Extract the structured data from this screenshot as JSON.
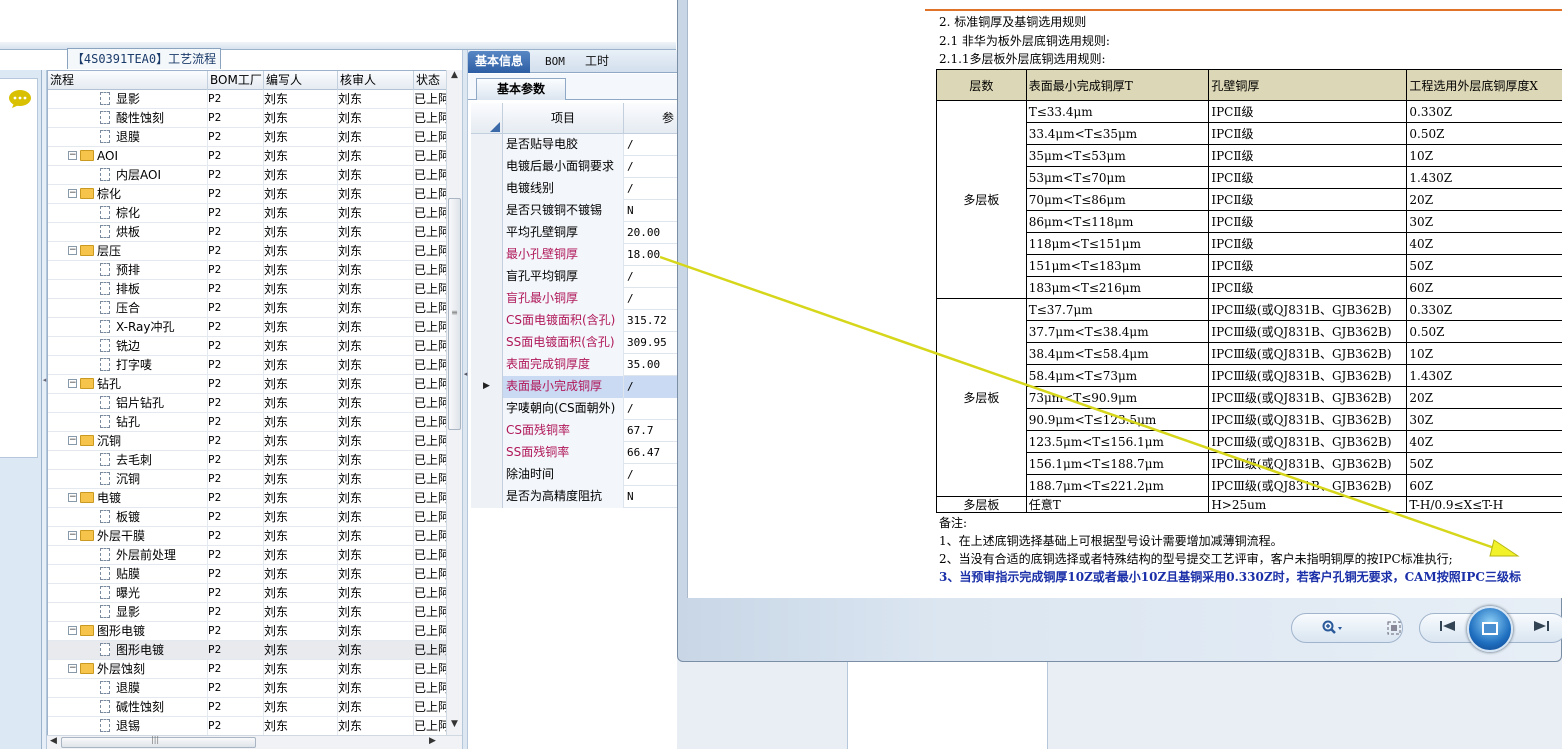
{
  "process_tab": {
    "title": "【4S0391TEA0】工艺流程"
  },
  "tree": {
    "columns": [
      "流程",
      "BOM工厂",
      "编写人",
      "核审人",
      "状态"
    ],
    "rows": [
      {
        "name": "显影",
        "level": 2,
        "bom": "P2",
        "writer": "刘东",
        "checker": "刘东",
        "status": "已上阿"
      },
      {
        "name": "酸性蚀刻",
        "level": 2,
        "bom": "P2",
        "writer": "刘东",
        "checker": "刘东",
        "status": "已上阿"
      },
      {
        "name": "退膜",
        "level": 2,
        "bom": "P2",
        "writer": "刘东",
        "checker": "刘东",
        "status": "已上阿"
      },
      {
        "name": "AOI",
        "level": 1,
        "bom": "P2",
        "writer": "刘东",
        "checker": "刘东",
        "status": "已上阿"
      },
      {
        "name": "内层AOI",
        "level": 2,
        "bom": "P2",
        "writer": "刘东",
        "checker": "刘东",
        "status": "已上阿"
      },
      {
        "name": "棕化",
        "level": 1,
        "bom": "P2",
        "writer": "刘东",
        "checker": "刘东",
        "status": "已上阿"
      },
      {
        "name": "棕化",
        "level": 2,
        "bom": "P2",
        "writer": "刘东",
        "checker": "刘东",
        "status": "已上阿"
      },
      {
        "name": "烘板",
        "level": 2,
        "bom": "P2",
        "writer": "刘东",
        "checker": "刘东",
        "status": "已上阿"
      },
      {
        "name": "层压",
        "level": 1,
        "bom": "P2",
        "writer": "刘东",
        "checker": "刘东",
        "status": "已上阿"
      },
      {
        "name": "预排",
        "level": 2,
        "bom": "P2",
        "writer": "刘东",
        "checker": "刘东",
        "status": "已上阿"
      },
      {
        "name": "排板",
        "level": 2,
        "bom": "P2",
        "writer": "刘东",
        "checker": "刘东",
        "status": "已上阿"
      },
      {
        "name": "压合",
        "level": 2,
        "bom": "P2",
        "writer": "刘东",
        "checker": "刘东",
        "status": "已上阿"
      },
      {
        "name": "X-Ray冲孔",
        "level": 2,
        "bom": "P2",
        "writer": "刘东",
        "checker": "刘东",
        "status": "已上阿"
      },
      {
        "name": "铣边",
        "level": 2,
        "bom": "P2",
        "writer": "刘东",
        "checker": "刘东",
        "status": "已上阿"
      },
      {
        "name": "打字唛",
        "level": 2,
        "bom": "P2",
        "writer": "刘东",
        "checker": "刘东",
        "status": "已上阿"
      },
      {
        "name": "钻孔",
        "level": 1,
        "bom": "P2",
        "writer": "刘东",
        "checker": "刘东",
        "status": "已上阿"
      },
      {
        "name": "铝片钻孔",
        "level": 2,
        "bom": "P2",
        "writer": "刘东",
        "checker": "刘东",
        "status": "已上阿"
      },
      {
        "name": "钻孔",
        "level": 2,
        "bom": "P2",
        "writer": "刘东",
        "checker": "刘东",
        "status": "已上阿"
      },
      {
        "name": "沉铜",
        "level": 1,
        "bom": "P2",
        "writer": "刘东",
        "checker": "刘东",
        "status": "已上阿"
      },
      {
        "name": "去毛刺",
        "level": 2,
        "bom": "P2",
        "writer": "刘东",
        "checker": "刘东",
        "status": "已上阿"
      },
      {
        "name": "沉铜",
        "level": 2,
        "bom": "P2",
        "writer": "刘东",
        "checker": "刘东",
        "status": "已上阿"
      },
      {
        "name": "电镀",
        "level": 1,
        "bom": "P2",
        "writer": "刘东",
        "checker": "刘东",
        "status": "已上阿"
      },
      {
        "name": "板镀",
        "level": 2,
        "bom": "P2",
        "writer": "刘东",
        "checker": "刘东",
        "status": "已上阿"
      },
      {
        "name": "外层干膜",
        "level": 1,
        "bom": "P2",
        "writer": "刘东",
        "checker": "刘东",
        "status": "已上阿"
      },
      {
        "name": "外层前处理",
        "level": 2,
        "bom": "P2",
        "writer": "刘东",
        "checker": "刘东",
        "status": "已上阿"
      },
      {
        "name": "贴膜",
        "level": 2,
        "bom": "P2",
        "writer": "刘东",
        "checker": "刘东",
        "status": "已上阿"
      },
      {
        "name": "曝光",
        "level": 2,
        "bom": "P2",
        "writer": "刘东",
        "checker": "刘东",
        "status": "已上阿"
      },
      {
        "name": "显影",
        "level": 2,
        "bom": "P2",
        "writer": "刘东",
        "checker": "刘东",
        "status": "已上阿"
      },
      {
        "name": "图形电镀",
        "level": 1,
        "bom": "P2",
        "writer": "刘东",
        "checker": "刘东",
        "status": "已上阿"
      },
      {
        "name": "图形电镀",
        "level": 2,
        "bom": "P2",
        "writer": "刘东",
        "checker": "刘东",
        "status": "已上阿",
        "selected": true
      },
      {
        "name": "外层蚀刻",
        "level": 1,
        "bom": "P2",
        "writer": "刘东",
        "checker": "刘东",
        "status": "已上阿"
      },
      {
        "name": "退膜",
        "level": 2,
        "bom": "P2",
        "writer": "刘东",
        "checker": "刘东",
        "status": "已上阿"
      },
      {
        "name": "碱性蚀刻",
        "level": 2,
        "bom": "P2",
        "writer": "刘东",
        "checker": "刘东",
        "status": "已上阿"
      },
      {
        "name": "退锡",
        "level": 2,
        "bom": "P2",
        "writer": "刘东",
        "checker": "刘东",
        "status": "已上阿"
      }
    ]
  },
  "param_panel": {
    "tabs": [
      "基本信息",
      "BOM",
      "工时"
    ],
    "active_tab": "基本信息",
    "subtab": "基本参数",
    "headers": [
      "项目",
      "参"
    ],
    "rows": [
      {
        "name": "是否贴导电胶",
        "value": "/",
        "red": false
      },
      {
        "name": "电镀后最小面铜要求",
        "value": "/",
        "red": false
      },
      {
        "name": "电镀线别",
        "value": "/",
        "red": false
      },
      {
        "name": "是否只镀铜不镀锡",
        "value": "N",
        "red": false
      },
      {
        "name": "平均孔壁铜厚",
        "value": "20.00",
        "red": false
      },
      {
        "name": "最小孔壁铜厚",
        "value": "18.00",
        "red": true
      },
      {
        "name": "盲孔平均铜厚",
        "value": "/",
        "red": false
      },
      {
        "name": "盲孔最小铜厚",
        "value": "/",
        "red": true
      },
      {
        "name": "CS面电镀面积(含孔)",
        "value": "315.72",
        "red": true
      },
      {
        "name": "SS面电镀面积(含孔)",
        "value": "309.95",
        "red": true
      },
      {
        "name": "表面完成铜厚度",
        "value": "35.00",
        "red": true
      },
      {
        "name": "表面最小完成铜厚",
        "value": "/",
        "red": true,
        "current": true
      },
      {
        "name": "字唛朝向(CS面朝外)",
        "value": "/",
        "red": false
      },
      {
        "name": "CS面残铜率",
        "value": "67.7",
        "red": true
      },
      {
        "name": "SS面残铜率",
        "value": "66.47",
        "red": true
      },
      {
        "name": "除油时间",
        "value": "/",
        "red": false
      },
      {
        "name": "是否为高精度阻抗",
        "value": "N",
        "red": false
      }
    ]
  },
  "document": {
    "heading1": "2. 标准铜厚及基铜选用规则",
    "heading2": "2.1 非华为板外层底铜选用规则:",
    "heading3": "2.1.1多层板外层底铜选用规则:",
    "table_headers": [
      "层数",
      "表面最小完成铜厚T",
      "孔壁铜厚",
      "工程选用外层底铜厚度X"
    ],
    "group1_label": "多层板",
    "group1": [
      {
        "t": "T≤33.4μm",
        "hole": "IPCⅡ级",
        "x": "0.330Z"
      },
      {
        "t": "33.4μm<T≤35μm",
        "hole": "IPCⅡ级",
        "x": "0.50Z"
      },
      {
        "t": "35μm<T≤53μm",
        "hole": "IPCⅡ级",
        "x": "10Z"
      },
      {
        "t": "53μm<T≤70μm",
        "hole": "IPCⅡ级",
        "x": "1.430Z"
      },
      {
        "t": "70μm<T≤86μm",
        "hole": "IPCⅡ级",
        "x": "20Z"
      },
      {
        "t": "86μm<T≤118μm",
        "hole": "IPCⅡ级",
        "x": "30Z"
      },
      {
        "t": "118μm<T≤151μm",
        "hole": "IPCⅡ级",
        "x": "40Z"
      },
      {
        "t": "151μm<T≤183μm",
        "hole": "IPCⅡ级",
        "x": "50Z"
      },
      {
        "t": "183μm<T≤216μm",
        "hole": "IPCⅡ级",
        "x": "60Z"
      }
    ],
    "group2_label": "多层板",
    "group2": [
      {
        "t": "T≤37.7μm",
        "hole": "IPCⅢ级(或QJ831B、GJB362B)",
        "x": "0.330Z"
      },
      {
        "t": "37.7μm<T≤38.4μm",
        "hole": "IPCⅢ级(或QJ831B、GJB362B)",
        "x": "0.50Z"
      },
      {
        "t": "38.4μm<T≤58.4μm",
        "hole": "IPCⅢ级(或QJ831B、GJB362B)",
        "x": "10Z"
      },
      {
        "t": "58.4μm<T≤73μm",
        "hole": "IPCⅢ级(或QJ831B、GJB362B)",
        "x": "1.430Z"
      },
      {
        "t": "73μm<T≤90.9μm",
        "hole": "IPCⅢ级(或QJ831B、GJB362B)",
        "x": "20Z"
      },
      {
        "t": "90.9μm<T≤123.5μm",
        "hole": "IPCⅢ级(或QJ831B、GJB362B)",
        "x": "30Z"
      },
      {
        "t": "123.5μm<T≤156.1μm",
        "hole": "IPCⅢ级(或QJ831B、GJB362B)",
        "x": "40Z"
      },
      {
        "t": "156.1μm<T≤188.7μm",
        "hole": "IPCⅢ级(或QJ831B、GJB362B)",
        "x": "50Z"
      },
      {
        "t": "188.7μm<T≤221.2μm",
        "hole": "IPCⅢ级(或QJ831B、GJB362B)",
        "x": "60Z"
      }
    ],
    "last_row": {
      "layer": "多层板",
      "t": "任意T",
      "hole": "H>25um",
      "x": "T-H/0.9≤X≤T-H"
    },
    "notes_title": "备注:",
    "note1": "1、在上述底铜选择基础上可根据型号设计需要增加减薄铜流程。",
    "note2": "2、当没有合适的底铜选择或者特殊结构的型号提交工艺评审，客户未指明铜厚的按IPC标准执行;",
    "note3": "3、当预审指示完成铜厚10Z或者最小10Z且基铜采用0.330Z时，若客户孔铜无要求，CAM按照IPC三级标"
  },
  "viewer_toolbar": {
    "zoom_icon": "zoom-icon",
    "fit_icon": "actual-size-icon",
    "prev_icon": "previous-icon",
    "slideshow_icon": "slideshow-icon",
    "next_icon": "next-icon"
  },
  "colors": {
    "accent_tab": "#2d5ea4",
    "red_label": "#b0185a",
    "arrow": "#f2f22a",
    "doc_header_bg": "#dcd7b6",
    "note_blue": "#1a2fa8"
  }
}
